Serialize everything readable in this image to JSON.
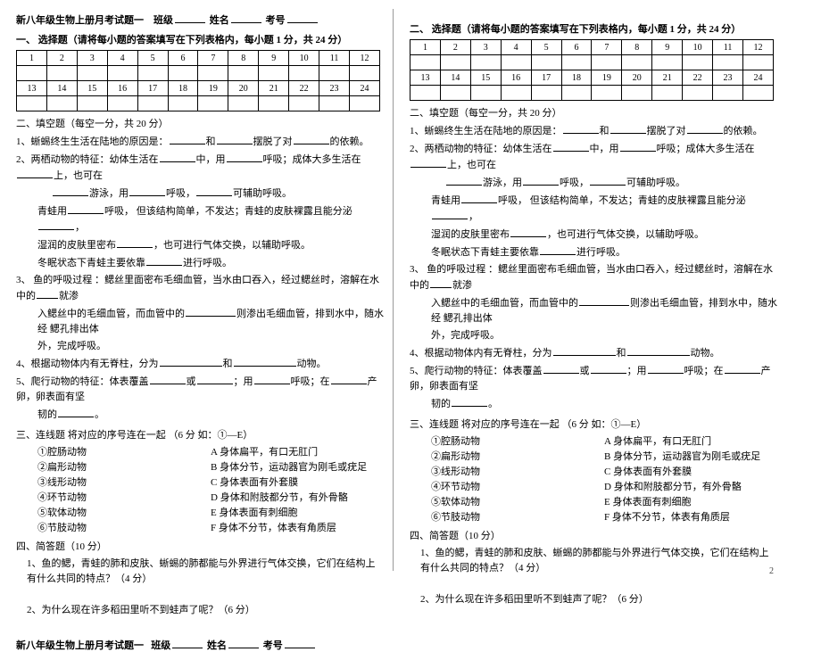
{
  "header": {
    "title": "新八年级生物上册月考试题一",
    "class_label": "班级",
    "name_label": "姓名",
    "num_label": "考号"
  },
  "s1_title": "一、 选择题（请将每小题的答案填写在下列表格内，每小题 1 分，共 24 分）",
  "s1r_title": "二、 选择题（请将每小题的答案填写在下列表格内，每小题 1 分，共 24 分）",
  "table_nums": [
    "1",
    "2",
    "3",
    "4",
    "5",
    "6",
    "7",
    "8",
    "9",
    "10",
    "11",
    "12",
    "13",
    "14",
    "15",
    "16",
    "17",
    "18",
    "19",
    "20",
    "21",
    "22",
    "23",
    "24"
  ],
  "s2_title": "二、填空题（每空一分，共 20 分）",
  "q1_a": "1、蜥蜴终生生活在陆地的原因是：",
  "q1_b": "和",
  "q1_c": "摆脱了对",
  "q1_d": "的依赖。",
  "q2_a": "2、两栖动物的特征：幼体生活在",
  "q2_b": "中，用",
  "q2_c": "呼吸；成体大多生活在",
  "q2_d": "上，也可在",
  "q2_e": "游泳，用",
  "q2_f": "呼吸，",
  "q2_g": "可辅助呼吸。",
  "q2_h": "青蛙用",
  "q2_i": "呼吸， 但该结构简单，不发达；青蛙的皮肤裸露且能分泌",
  "q2_j": "，",
  "q2_k": "湿润的皮肤里密布",
  "q2_l": "，也可进行气体交换，以辅助呼吸。",
  "q2_m": "冬眠状态下青蛙主要依靠",
  "q2_n": "进行呼吸。",
  "q3_a": "3、 鱼的呼吸过程 ：鳃丝里面密布毛细血管，当水由口吞入，经过鳃丝时，溶解在水中的",
  "q3_b": "就渗",
  "q3_c": "入鳃丝中的毛细血管，而血管中的",
  "q3_d": "则渗出毛细血管，排到水中，随水经  鳃孔排出体",
  "q3_e": "外，完成呼吸。",
  "q4_a": "4、根据动物体内有无脊柱，分为",
  "q4_b": "和",
  "q4_c": "动物。",
  "q5_a": "5、爬行动物的特征：体表覆盖",
  "q5_b": "或",
  "q5_c": "；用",
  "q5_d": "呼吸；在",
  "q5_e": "产卵，卵表面有坚",
  "q5_f": "韧的",
  "q5_g": "。",
  "s3_title": "三、连线题  将对应的序号连在一起  （6 分   如：①—E）",
  "m_left": [
    "①腔肠动物",
    "②扁形动物",
    "③线形动物",
    "④环节动物",
    "⑤软体动物",
    "⑥节肢动物"
  ],
  "m_right": [
    "A 身体扁平，有口无肛门",
    "B 身体分节，运动器官为刚毛或疣足",
    "C 身体表面有外套膜",
    "D 身体和附肢都分节，有外骨骼",
    "E 身体表面有刺细胞",
    "F 身体不分节，体表有角质层"
  ],
  "s4_title": "四、简答题（10 分）",
  "q4_1": "1、鱼的鳃，青蛙的肺和皮肤、蜥蜴的肺都能与外界进行气体交换，它们在结构上有什么共同的特点？（4 分）",
  "q4_2": "2、为什么现在许多稻田里听不到蛙声了呢？（6 分）",
  "page": "2"
}
